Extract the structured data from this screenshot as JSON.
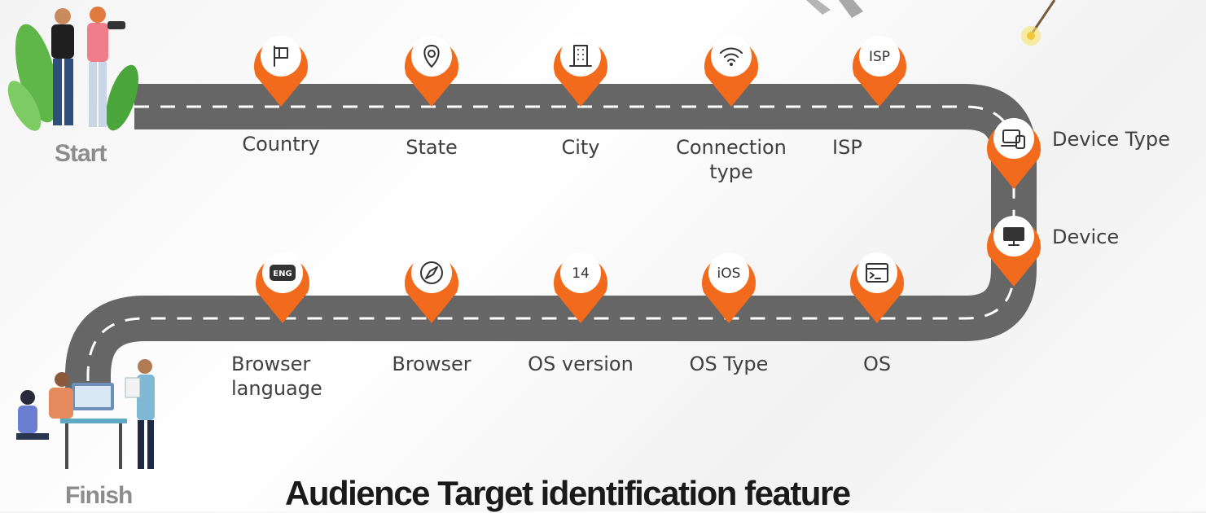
{
  "endpoints": {
    "start": "Start",
    "finish": "Finish"
  },
  "title": "Audience Target identification feature",
  "colors": {
    "pin": "#f26b1d",
    "road": "#666666",
    "road_dash": "#ffffff",
    "label": "#404040"
  },
  "top_row": [
    {
      "label": "Country",
      "icon": "flag-icon"
    },
    {
      "label": "State",
      "icon": "location-pin-icon"
    },
    {
      "label": "City",
      "icon": "building-icon"
    },
    {
      "label": "Connection\ntype",
      "icon": "wifi-icon"
    },
    {
      "label": "ISP",
      "icon": "isp-icon",
      "icon_text": "ISP"
    }
  ],
  "right_column": [
    {
      "label": "Device Type",
      "icon": "device-type-icon"
    },
    {
      "label": "Device",
      "icon": "monitor-icon"
    }
  ],
  "bottom_row": [
    {
      "label": "OS",
      "icon": "terminal-window-icon"
    },
    {
      "label": "OS Type",
      "icon": "ios-icon",
      "icon_text": "iOS"
    },
    {
      "label": "OS version",
      "icon": "version-icon",
      "icon_text": "14"
    },
    {
      "label": "Browser",
      "icon": "compass-icon"
    },
    {
      "label": "Browser\nlanguage",
      "icon": "language-icon",
      "icon_text": "ENG"
    }
  ]
}
